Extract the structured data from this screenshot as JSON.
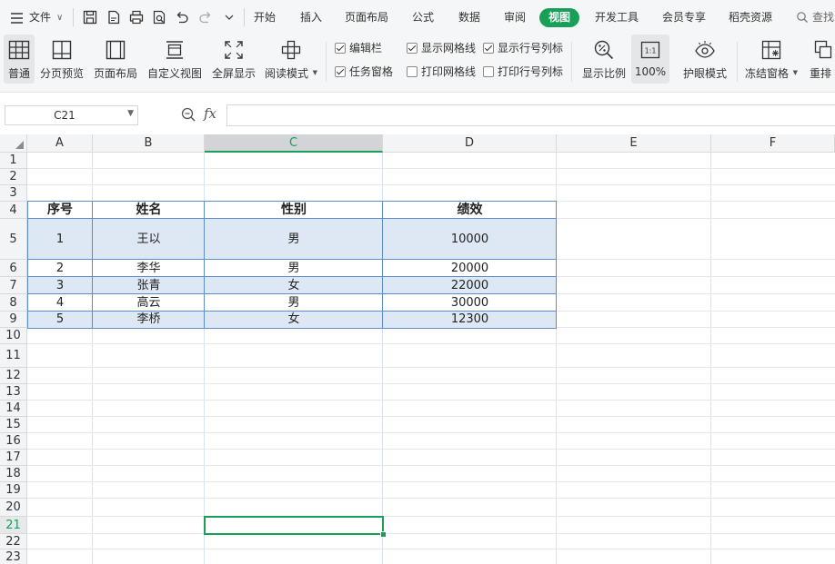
{
  "menu": {
    "file_label": "文件",
    "tabs": [
      "开始",
      "插入",
      "页面布局",
      "公式",
      "数据",
      "审阅",
      "视图",
      "开发工具",
      "会员专享",
      "稻壳资源"
    ],
    "active_tab": "视图",
    "search_label": "查找"
  },
  "ribbon": {
    "buttons": {
      "normal": "普通",
      "page_break_preview": "分页预览",
      "page_layout": "页面布局",
      "custom_view": "自定义视图",
      "full_screen": "全屏显示",
      "reading_mode": "阅读模式",
      "zoom": "显示比例",
      "zoom_100": "100%",
      "zoom_100_icon_text": "1:1",
      "eye_protection": "护眼模式",
      "freeze_panes": "冻结窗格",
      "rearrange": "重排"
    },
    "checks": {
      "formula_bar": {
        "label": "编辑栏",
        "checked": true
      },
      "task_pane": {
        "label": "任务窗格",
        "checked": true
      },
      "gridlines": {
        "label": "显示网格线",
        "checked": true
      },
      "print_gridlines": {
        "label": "打印网格线",
        "checked": false
      },
      "headings": {
        "label": "显示行号列标",
        "checked": true
      },
      "print_headings": {
        "label": "打印行号列标",
        "checked": false
      }
    }
  },
  "formula_bar": {
    "name_box": "C21",
    "fx_label": "fx",
    "formula": ""
  },
  "sheet": {
    "columns": [
      "A",
      "B",
      "C",
      "D",
      "E",
      "F"
    ],
    "selected_column": "C",
    "rows": [
      "1",
      "2",
      "3",
      "4",
      "5",
      "6",
      "7",
      "8",
      "9",
      "10",
      "11",
      "12",
      "13",
      "14",
      "15",
      "16",
      "17",
      "18",
      "19",
      "20",
      "21",
      "22",
      "23"
    ],
    "selected_row": "21",
    "table": {
      "headers": [
        "序号",
        "姓名",
        "性别",
        "绩效"
      ],
      "rows": [
        [
          "1",
          "王以",
          "男",
          "10000"
        ],
        [
          "2",
          "李华",
          "男",
          "20000"
        ],
        [
          "3",
          "张青",
          "女",
          "22000"
        ],
        [
          "4",
          "高云",
          "男",
          "30000"
        ],
        [
          "5",
          "李桥",
          "女",
          "12300"
        ]
      ]
    }
  },
  "colors": {
    "accent": "#18a058",
    "table_band": "#dde8f4",
    "table_border": "#5b8ec9"
  }
}
